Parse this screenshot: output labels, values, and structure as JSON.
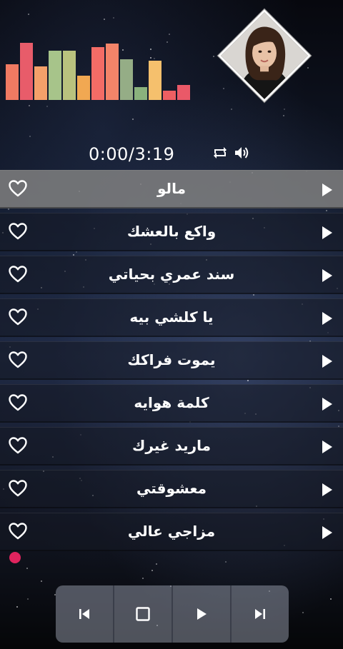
{
  "player": {
    "time": "0:00/3:19",
    "cover_alt": "artist photo"
  },
  "equalizer": {
    "levels": [
      0.5,
      0.8,
      0.47,
      0.69,
      0.69,
      0.34,
      0.74,
      0.79,
      0.57,
      0.18,
      0.55,
      0.13,
      0.21
    ],
    "colors": [
      "#f07a62",
      "#e85c6a",
      "#f4a06a",
      "#a7c48a",
      "#b9c27e",
      "#f1a852",
      "#f36c66",
      "#f38469",
      "#95ad86",
      "#8ab27d",
      "#f5c06d",
      "#ee5f62",
      "#ea5968"
    ]
  },
  "icons": {
    "repeat": "repeat-icon",
    "volume": "volume-icon",
    "heart": "heart-outline-icon",
    "play": "play-triangle-icon",
    "prev": "skip-previous-icon",
    "stop": "stop-icon",
    "play_main": "play-icon",
    "next": "skip-next-icon"
  },
  "tracks": [
    {
      "title": "مالو",
      "active": true
    },
    {
      "title": "واكع بالعشك",
      "active": false
    },
    {
      "title": "سند عمري بحياتي",
      "active": false
    },
    {
      "title": "يا كلشي بيه",
      "active": false
    },
    {
      "title": "يموت فراكك",
      "active": false
    },
    {
      "title": "كلمة هوايه",
      "active": false
    },
    {
      "title": "ماريد غيرك",
      "active": false
    },
    {
      "title": "معشوقتي",
      "active": false
    },
    {
      "title": "مزاجي عالي",
      "active": false
    }
  ],
  "colors": {
    "accent_dot": "#e0245e",
    "active_row": "#808080"
  }
}
